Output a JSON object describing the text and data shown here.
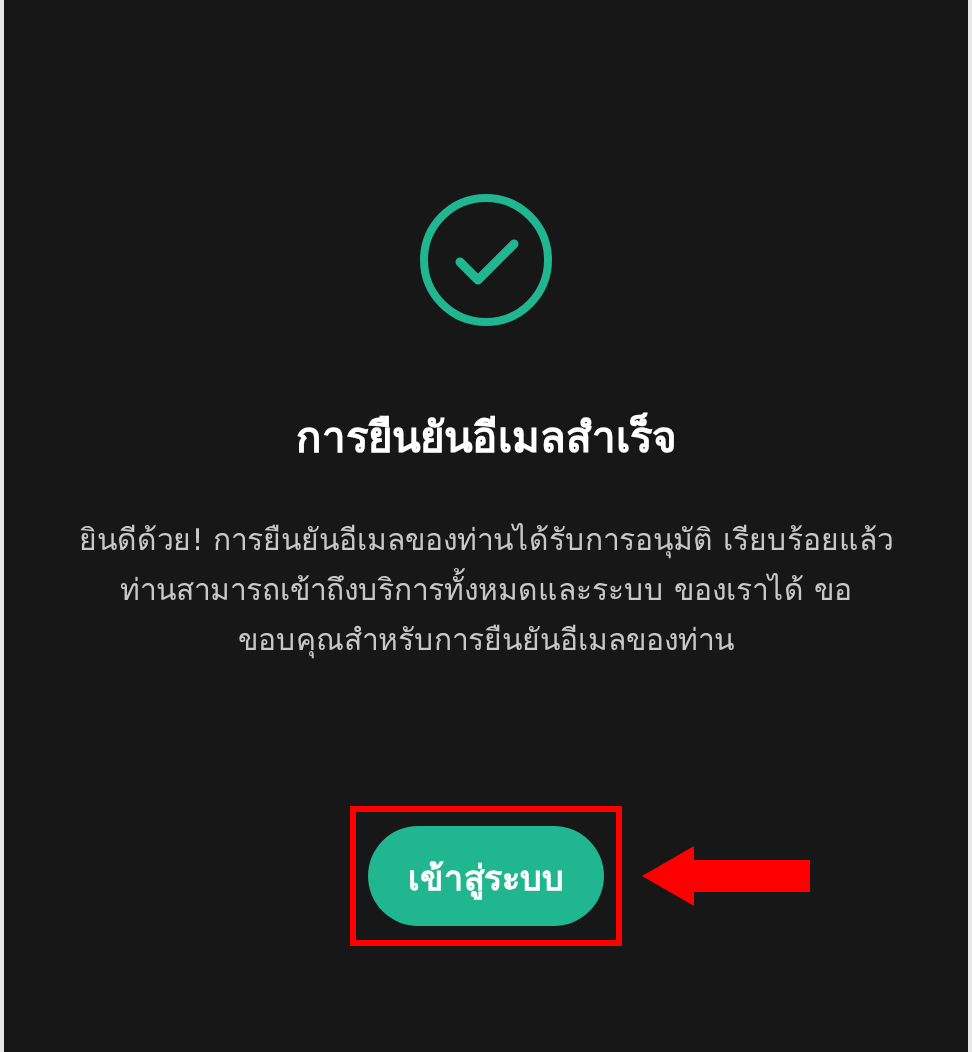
{
  "dialog": {
    "title": "การยืนยันอีเมลสำเร็จ",
    "message": "ยินดีด้วย! การยืนยันอีเมลของท่านได้รับการอนุมัติ เรียบร้อยแล้ว\nท่านสามารถเข้าถึงบริการทั้งหมดและระบบ ของเราได้ ขอ\nขอบคุณสำหรับการยืนยันอีเมลของท่าน",
    "button": {
      "label": "เข้าสู่ระบบ",
      "highlighted": true
    }
  }
}
